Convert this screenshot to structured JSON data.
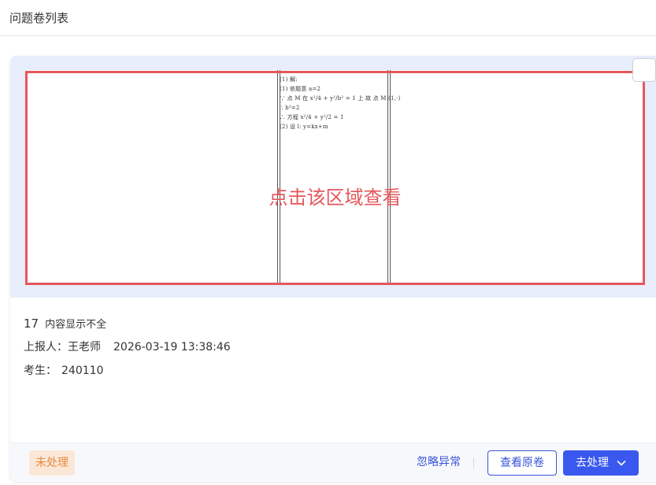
{
  "page": {
    "title": "问题卷列表"
  },
  "card": {
    "preview": {
      "hint": "点击该区域查看",
      "handwriting_lines": [
        "(1) 解:",
        "(1) 依题意 a=2",
        "∵ 点 M 在 x²/4 + y²/b² = 1 上 故 点 M (1,·)",
        "∴ b²=2",
        "∴ 方程 x²/4 + y²/2 = 1",
        "(2) 设 l: y=kx+m"
      ]
    },
    "issue": {
      "number": "17",
      "description": "内容显示不全"
    },
    "reporter": {
      "label": "上报人：",
      "name": "王老师",
      "time": "2026-03-19 13:38:46"
    },
    "examinee": {
      "label": "考生：",
      "id": "240110"
    },
    "footer": {
      "status": "未处理",
      "ignore_label": "忽略异常",
      "view_label": "查看原卷",
      "process_label": "去处理"
    }
  },
  "colors": {
    "accent": "#3a58f0",
    "highlight": "#e5575b",
    "status_bg": "#fbe7d8",
    "status_text": "#e98a3e",
    "preview_bg": "#e8edfb"
  },
  "icons": {
    "select": "checkbox-icon",
    "process_dropdown": "chevron-down-icon"
  }
}
